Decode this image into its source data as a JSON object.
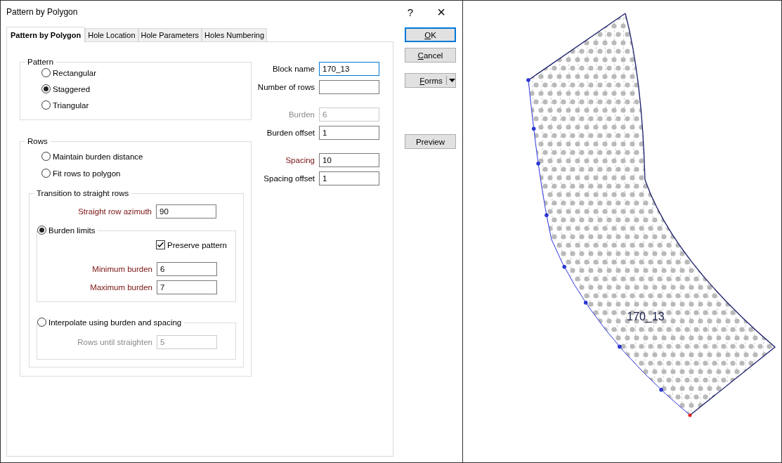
{
  "window": {
    "title": "Pattern by Polygon",
    "help": "?",
    "close": "×"
  },
  "tabs": [
    {
      "label": "Pattern by Polygon",
      "selected": true
    },
    {
      "label": "Hole Location",
      "selected": false
    },
    {
      "label": "Hole Parameters",
      "selected": false
    },
    {
      "label": "Holes Numbering",
      "selected": false
    }
  ],
  "pattern_group": {
    "title": "Pattern",
    "options": [
      {
        "label": "Rectangular",
        "selected": false
      },
      {
        "label": "Staggered",
        "selected": true
      },
      {
        "label": "Triangular",
        "selected": false
      }
    ]
  },
  "rows_group": {
    "title": "Rows",
    "options": [
      {
        "label": "Maintain burden distance",
        "selected": false
      },
      {
        "label": "Fit rows to polygon",
        "selected": false
      }
    ],
    "transition": {
      "title": "Transition to straight rows",
      "azimuth": {
        "label": "Straight row azimuth",
        "value": "90",
        "required": true,
        "disabled": false,
        "focused": false
      },
      "burden_limits": {
        "label": "Burden limits",
        "selected": true,
        "preserve": {
          "label": "Preserve pattern",
          "checked": true
        },
        "fields": [
          {
            "label": "Minimum burden",
            "value": "6",
            "required": true,
            "disabled": false,
            "focused": false
          },
          {
            "label": "Maximum burden",
            "value": "7",
            "required": true,
            "disabled": false,
            "focused": false
          }
        ]
      },
      "interpolate": {
        "label": "Interpolate using burden and spacing",
        "selected": false,
        "field": {
          "label": "Rows until straighten",
          "value": "5",
          "required": false,
          "disabled": true,
          "focused": false
        }
      }
    }
  },
  "field_groups": [
    {
      "fields": [
        {
          "label": "Block name",
          "value": "170_13",
          "required": false,
          "disabled": false,
          "focused": true
        },
        {
          "label": "Number of rows",
          "required": false,
          "disabled": false,
          "focused": false
        }
      ]
    },
    {
      "fields": [
        {
          "label": "Burden",
          "value": "6",
          "required": false,
          "disabled": true,
          "focused": false
        },
        {
          "label": "Burden offset",
          "value": "1",
          "required": false,
          "disabled": false,
          "focused": false
        }
      ]
    },
    {
      "fields": [
        {
          "label": "Spacing",
          "value": "10",
          "required": true,
          "disabled": false,
          "focused": false
        },
        {
          "label": "Spacing offset",
          "value": "1",
          "required": false,
          "disabled": false,
          "focused": false
        }
      ]
    }
  ],
  "buttons": [
    {
      "label": "OK",
      "kind": "default",
      "access_key_underlined": true
    },
    {
      "label": "Cancel",
      "kind": "plain",
      "access_key_underlined": true
    },
    {
      "label": "Forms",
      "kind": "split",
      "access_key_underlined": true
    },
    {
      "label": "Preview",
      "kind": "separated",
      "access_key_underlined": false
    }
  ],
  "view": {
    "block_label": "170_13"
  }
}
